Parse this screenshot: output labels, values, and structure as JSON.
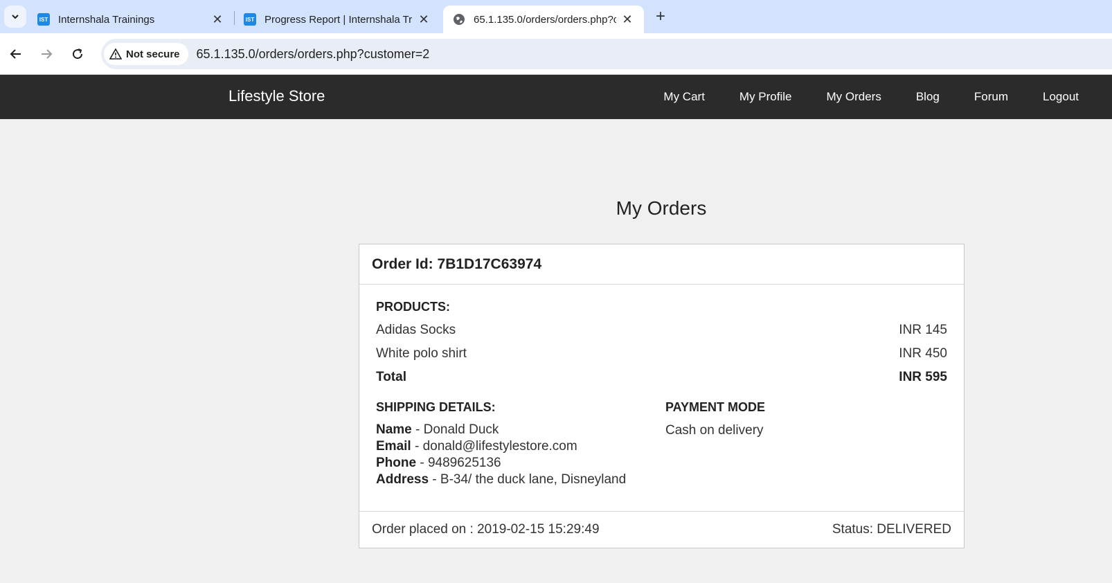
{
  "browser": {
    "tabs": [
      {
        "favicon": "IST",
        "title": "Internshala Trainings",
        "active": false
      },
      {
        "favicon": "IST",
        "title": "Progress Report | Internshala Tr",
        "active": false
      },
      {
        "favicon": "globe-icon",
        "title": "65.1.135.0/orders/orders.php?cu",
        "active": true
      }
    ],
    "security_label": "Not secure",
    "url": "65.1.135.0/orders/orders.php?customer=2"
  },
  "site": {
    "brand": "Lifestyle Store",
    "nav": [
      "My Cart",
      "My Profile",
      "My Orders",
      "Blog",
      "Forum",
      "Logout"
    ]
  },
  "page": {
    "title": "My Orders"
  },
  "order": {
    "id_label": "Order Id: 7B1D17C63974",
    "products_label": "PRODUCTS:",
    "products": [
      {
        "name": "Adidas Socks",
        "price": "INR 145"
      },
      {
        "name": "White polo shirt",
        "price": "INR 450"
      }
    ],
    "total_label": "Total",
    "total_value": "INR 595",
    "shipping_label": "SHIPPING DETAILS:",
    "shipping": {
      "name_key": "Name",
      "name_value": " - Donald Duck",
      "email_key": "Email",
      "email_value": " - donald@lifestylestore.com",
      "phone_key": "Phone",
      "phone_value": " - 9489625136",
      "address_key": "Address",
      "address_value": " - B-34/ the duck lane, Disneyland"
    },
    "payment_label": "PAYMENT MODE",
    "payment_value": "Cash on delivery",
    "placed_on": "Order placed on : 2019-02-15 15:29:49",
    "status": "Status: DELIVERED"
  },
  "colors": {
    "tabstrip": "#d3e3fd",
    "navbar": "#2b2b2b",
    "page_bg": "#f0f0f0"
  }
}
